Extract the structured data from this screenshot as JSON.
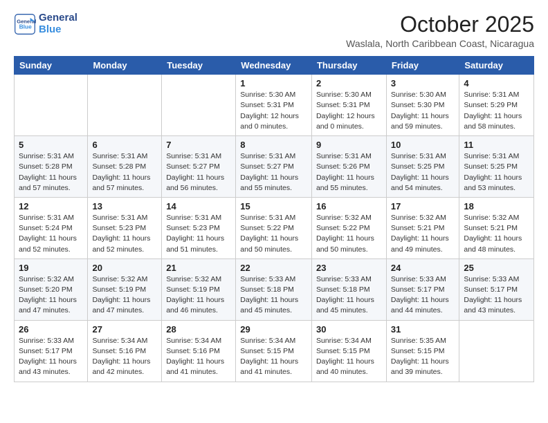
{
  "header": {
    "logo_line1": "General",
    "logo_line2": "Blue",
    "month": "October 2025",
    "location": "Waslala, North Caribbean Coast, Nicaragua"
  },
  "weekdays": [
    "Sunday",
    "Monday",
    "Tuesday",
    "Wednesday",
    "Thursday",
    "Friday",
    "Saturday"
  ],
  "weeks": [
    [
      {
        "day": "",
        "info": ""
      },
      {
        "day": "",
        "info": ""
      },
      {
        "day": "",
        "info": ""
      },
      {
        "day": "1",
        "info": "Sunrise: 5:30 AM\nSunset: 5:31 PM\nDaylight: 12 hours\nand 0 minutes."
      },
      {
        "day": "2",
        "info": "Sunrise: 5:30 AM\nSunset: 5:31 PM\nDaylight: 12 hours\nand 0 minutes."
      },
      {
        "day": "3",
        "info": "Sunrise: 5:30 AM\nSunset: 5:30 PM\nDaylight: 11 hours\nand 59 minutes."
      },
      {
        "day": "4",
        "info": "Sunrise: 5:31 AM\nSunset: 5:29 PM\nDaylight: 11 hours\nand 58 minutes."
      }
    ],
    [
      {
        "day": "5",
        "info": "Sunrise: 5:31 AM\nSunset: 5:28 PM\nDaylight: 11 hours\nand 57 minutes."
      },
      {
        "day": "6",
        "info": "Sunrise: 5:31 AM\nSunset: 5:28 PM\nDaylight: 11 hours\nand 57 minutes."
      },
      {
        "day": "7",
        "info": "Sunrise: 5:31 AM\nSunset: 5:27 PM\nDaylight: 11 hours\nand 56 minutes."
      },
      {
        "day": "8",
        "info": "Sunrise: 5:31 AM\nSunset: 5:27 PM\nDaylight: 11 hours\nand 55 minutes."
      },
      {
        "day": "9",
        "info": "Sunrise: 5:31 AM\nSunset: 5:26 PM\nDaylight: 11 hours\nand 55 minutes."
      },
      {
        "day": "10",
        "info": "Sunrise: 5:31 AM\nSunset: 5:25 PM\nDaylight: 11 hours\nand 54 minutes."
      },
      {
        "day": "11",
        "info": "Sunrise: 5:31 AM\nSunset: 5:25 PM\nDaylight: 11 hours\nand 53 minutes."
      }
    ],
    [
      {
        "day": "12",
        "info": "Sunrise: 5:31 AM\nSunset: 5:24 PM\nDaylight: 11 hours\nand 52 minutes."
      },
      {
        "day": "13",
        "info": "Sunrise: 5:31 AM\nSunset: 5:23 PM\nDaylight: 11 hours\nand 52 minutes."
      },
      {
        "day": "14",
        "info": "Sunrise: 5:31 AM\nSunset: 5:23 PM\nDaylight: 11 hours\nand 51 minutes."
      },
      {
        "day": "15",
        "info": "Sunrise: 5:31 AM\nSunset: 5:22 PM\nDaylight: 11 hours\nand 50 minutes."
      },
      {
        "day": "16",
        "info": "Sunrise: 5:32 AM\nSunset: 5:22 PM\nDaylight: 11 hours\nand 50 minutes."
      },
      {
        "day": "17",
        "info": "Sunrise: 5:32 AM\nSunset: 5:21 PM\nDaylight: 11 hours\nand 49 minutes."
      },
      {
        "day": "18",
        "info": "Sunrise: 5:32 AM\nSunset: 5:21 PM\nDaylight: 11 hours\nand 48 minutes."
      }
    ],
    [
      {
        "day": "19",
        "info": "Sunrise: 5:32 AM\nSunset: 5:20 PM\nDaylight: 11 hours\nand 47 minutes."
      },
      {
        "day": "20",
        "info": "Sunrise: 5:32 AM\nSunset: 5:19 PM\nDaylight: 11 hours\nand 47 minutes."
      },
      {
        "day": "21",
        "info": "Sunrise: 5:32 AM\nSunset: 5:19 PM\nDaylight: 11 hours\nand 46 minutes."
      },
      {
        "day": "22",
        "info": "Sunrise: 5:33 AM\nSunset: 5:18 PM\nDaylight: 11 hours\nand 45 minutes."
      },
      {
        "day": "23",
        "info": "Sunrise: 5:33 AM\nSunset: 5:18 PM\nDaylight: 11 hours\nand 45 minutes."
      },
      {
        "day": "24",
        "info": "Sunrise: 5:33 AM\nSunset: 5:17 PM\nDaylight: 11 hours\nand 44 minutes."
      },
      {
        "day": "25",
        "info": "Sunrise: 5:33 AM\nSunset: 5:17 PM\nDaylight: 11 hours\nand 43 minutes."
      }
    ],
    [
      {
        "day": "26",
        "info": "Sunrise: 5:33 AM\nSunset: 5:17 PM\nDaylight: 11 hours\nand 43 minutes."
      },
      {
        "day": "27",
        "info": "Sunrise: 5:34 AM\nSunset: 5:16 PM\nDaylight: 11 hours\nand 42 minutes."
      },
      {
        "day": "28",
        "info": "Sunrise: 5:34 AM\nSunset: 5:16 PM\nDaylight: 11 hours\nand 41 minutes."
      },
      {
        "day": "29",
        "info": "Sunrise: 5:34 AM\nSunset: 5:15 PM\nDaylight: 11 hours\nand 41 minutes."
      },
      {
        "day": "30",
        "info": "Sunrise: 5:34 AM\nSunset: 5:15 PM\nDaylight: 11 hours\nand 40 minutes."
      },
      {
        "day": "31",
        "info": "Sunrise: 5:35 AM\nSunset: 5:15 PM\nDaylight: 11 hours\nand 39 minutes."
      },
      {
        "day": "",
        "info": ""
      }
    ]
  ]
}
